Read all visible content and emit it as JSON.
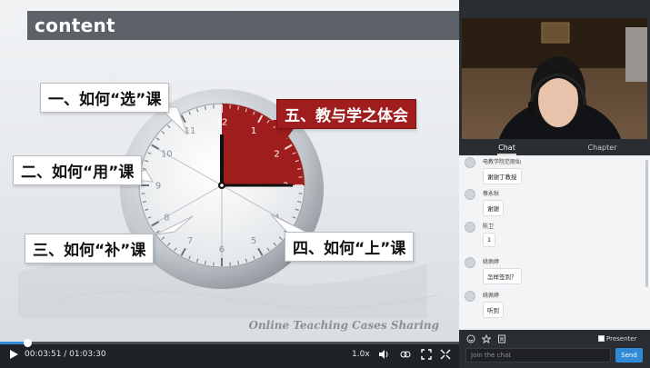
{
  "slide": {
    "header": "content",
    "callouts": {
      "c1": "一、如何“选”课",
      "c2": "二、如何“用”课",
      "c3": "三、如何“补”课",
      "c4": "四、如何“上”课",
      "c5": "五、教与学之体会"
    },
    "watermark": "Online Teaching Cases Sharing",
    "clock_numbers": [
      "12",
      "1",
      "2",
      "3",
      "4",
      "5",
      "6",
      "7",
      "8",
      "9",
      "10",
      "11"
    ]
  },
  "player": {
    "time": "00:03:51 / 01:03:30",
    "speed": "1.0x",
    "progress_fraction": 0.06,
    "icons": [
      "play-icon",
      "volume-icon",
      "sharing-icon",
      "fullscreen-icon"
    ]
  },
  "sidebar": {
    "tabs": [
      "Chat",
      "Chapter"
    ],
    "active_tab": "Chat",
    "messages": [
      {
        "name": "电教学院范丽仙",
        "text": "谢谢丁教授"
      },
      {
        "name": "蔡永秋",
        "text": "谢谢"
      },
      {
        "name": "陈卫",
        "text": "1"
      },
      {
        "name": "姚佩婷",
        "text": "怎样签到？"
      },
      {
        "name": "姚佩婷",
        "text": "听到"
      }
    ],
    "presenter_label": "Presenter",
    "chat_placeholder": "Join the chat",
    "send_label": "Send"
  },
  "colors": {
    "accent": "#2f8bd8",
    "slide_red": "#9f1d1d",
    "header_gray": "#5c6268"
  }
}
